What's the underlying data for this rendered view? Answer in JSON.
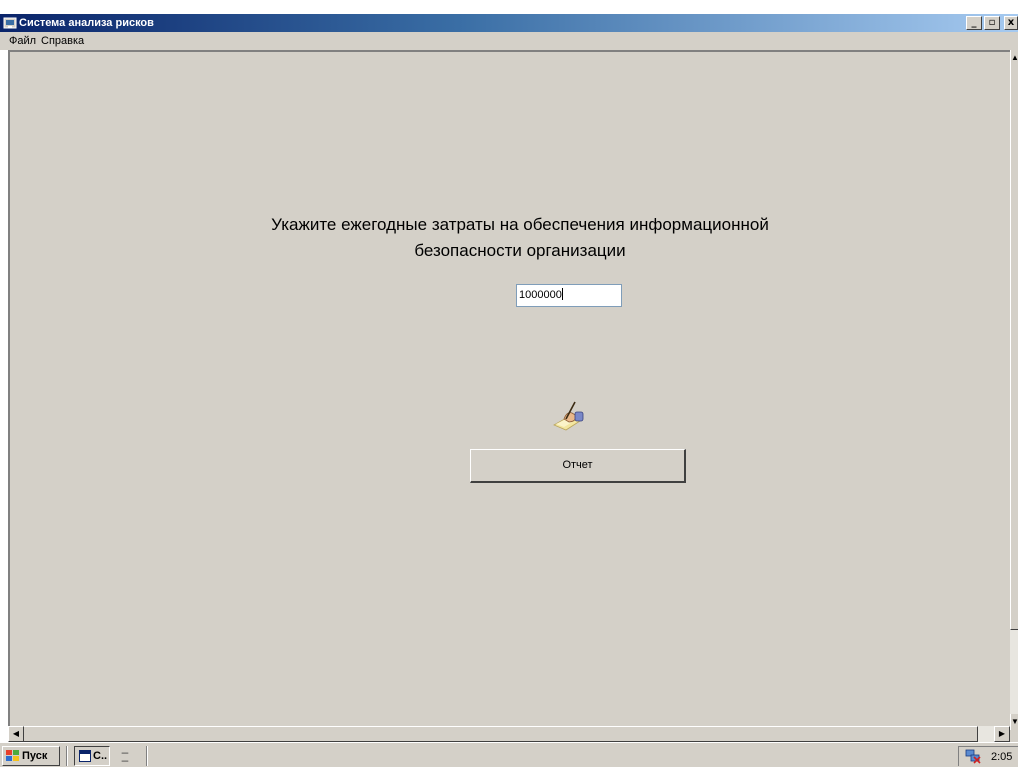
{
  "window": {
    "title": "Система анализа рисков",
    "controls": {
      "minimize": "_",
      "maximize": "▫",
      "close": "x"
    }
  },
  "menu": {
    "items": [
      {
        "label": "Файл"
      },
      {
        "label": "Справка"
      }
    ]
  },
  "main": {
    "prompt_line1": "Укажите ежегодные затраты на обеспечения информационной",
    "prompt_line2": "безопасности организации",
    "budget_value": "1000000",
    "report_icon": "writing-hand-icon",
    "report_button_label": "Отчет"
  },
  "taskbar": {
    "start_label": "Пуск",
    "task_label": "С..",
    "clock": "2:05"
  },
  "colors": {
    "titlebar_start": "#0a246a",
    "titlebar_end": "#a6caf0",
    "face": "#d4d0c8"
  }
}
